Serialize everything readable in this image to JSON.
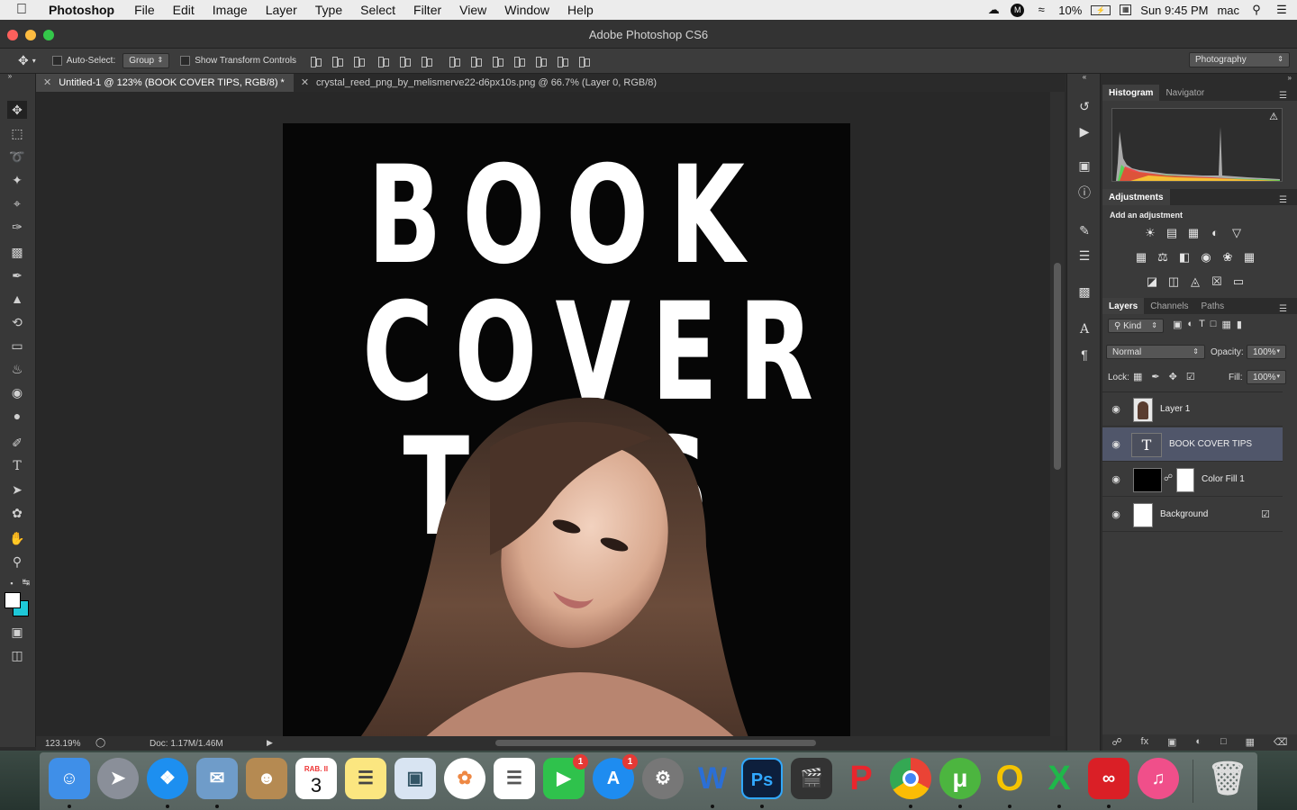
{
  "menubar": {
    "app_name": "Photoshop",
    "menus": [
      "File",
      "Edit",
      "Image",
      "Layer",
      "Type",
      "Select",
      "Filter",
      "View",
      "Window",
      "Help"
    ],
    "battery": "10%",
    "clock": "Sun 9:45 PM",
    "user": "mac"
  },
  "window": {
    "title": "Adobe Photoshop CS6"
  },
  "options": {
    "auto_select_label": "Auto-Select:",
    "auto_select_value": "Group",
    "transform_label": "Show Transform Controls",
    "workspace": "Photography"
  },
  "tabs": [
    {
      "label": "Untitled-1 @ 123% (BOOK COVER TIPS, RGB/8) *",
      "active": true
    },
    {
      "label": "crystal_reed_png_by_melismerve22-d6px10s.png @ 66.7% (Layer 0, RGB/8)",
      "active": false
    }
  ],
  "canvas": {
    "lines": [
      "BOOK",
      "COVER",
      "TIPS"
    ]
  },
  "status": {
    "zoom": "123.19%",
    "doc": "Doc: 1.17M/1.46M"
  },
  "panels": {
    "histogram_tab": "Histogram",
    "navigator_tab": "Navigator",
    "adjustments_title": "Adjustments",
    "add_adjustment": "Add an adjustment",
    "layers_tab": "Layers",
    "channels_tab": "Channels",
    "paths_tab": "Paths",
    "kind_label": "Kind",
    "blend_mode": "Normal",
    "opacity_label": "Opacity:",
    "opacity_value": "100%",
    "lock_label": "Lock:",
    "fill_label": "Fill:",
    "fill_value": "100%"
  },
  "layers": [
    {
      "name": "Layer 1",
      "selected": false
    },
    {
      "name": "BOOK COVER TIPS",
      "selected": true
    },
    {
      "name": "Color Fill 1",
      "selected": false
    },
    {
      "name": "Background",
      "selected": false
    }
  ],
  "dock": {
    "calendar_month": "RAB. II",
    "calendar_day": "3",
    "facetime_badge": "1",
    "appstore_badge": "1",
    "apps": [
      "finder-icon",
      "launchpad-icon",
      "safari-icon",
      "mail-icon",
      "contacts-icon",
      "calendar-icon",
      "notes-icon",
      "preview-icon",
      "photos-icon",
      "reminders-icon",
      "facetime-icon",
      "app-store-icon",
      "system-preferences-icon",
      "word-icon",
      "photoshop-icon",
      "final-cut-icon",
      "wps-icon",
      "chrome-icon",
      "utorrent-icon",
      "opera-icon",
      "excel-icon",
      "creative-cloud-icon",
      "itunes-icon",
      "trash-icon"
    ]
  },
  "colors": {
    "foreground": "#ffffff",
    "background_swatch": "#1ec8d8",
    "selected_layer": "#50566a"
  }
}
